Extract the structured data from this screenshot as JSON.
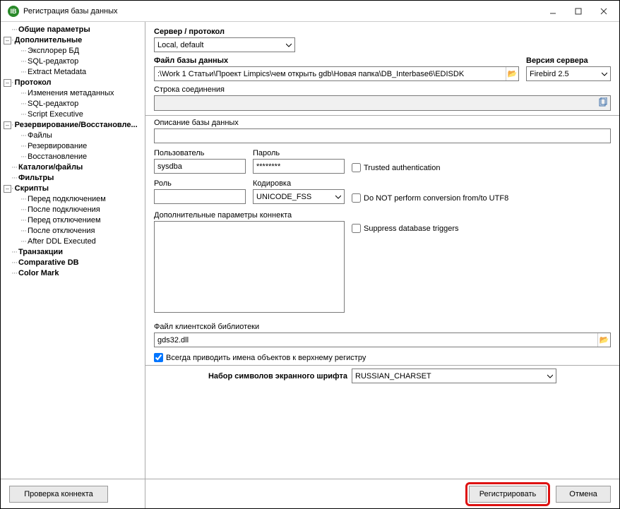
{
  "title": "Регистрация базы данных",
  "tree": {
    "general": "Общие параметры",
    "additional": "Дополнительные",
    "additional_children": [
      "Эксплорер БД",
      "SQL-редактор",
      "Extract Metadata"
    ],
    "protocol": "Протокол",
    "protocol_children": [
      "Изменения метаданных",
      "SQL-редактор",
      "Script Executive"
    ],
    "backup": "Резервирование/Восстановле...",
    "backup_children": [
      "Файлы",
      "Резервирование",
      "Восстановление"
    ],
    "catalogs": "Каталоги/файлы",
    "filters": "Фильтры",
    "scripts": "Скрипты",
    "scripts_children": [
      "Перед подключением",
      "После подключения",
      "Перед отключением",
      "После отключения",
      "After DDL Executed"
    ],
    "transactions": "Транзакции",
    "comparative": "Comparative DB",
    "colormark": "Color Mark"
  },
  "form": {
    "server_label": "Сервер / протокол",
    "server_value": "Local, default",
    "dbfile_label": "Файл базы данных",
    "dbfile_value": ":\\Work 1 Статьи\\Проект Limpics\\чем открыть gdb\\Новая папка\\DB_Interbase6\\EDISDK",
    "version_label": "Версия сервера",
    "version_value": "Firebird 2.5",
    "connstr_label": "Строка соединения",
    "desc_label": "Описание базы данных",
    "user_label": "Пользователь",
    "user_value": "sysdba",
    "pass_label": "Пароль",
    "pass_value": "********",
    "trusted_label": "Trusted authentication",
    "role_label": "Роль",
    "encoding_label": "Кодировка",
    "encoding_value": "UNICODE_FSS",
    "noconvert_label": "Do NOT perform conversion from/to UTF8",
    "addparams_label": "Дополнительные параметры коннекта",
    "suppress_label": "Suppress database triggers",
    "clientlib_label": "Файл клиентской библиотеки",
    "clientlib_value": "gds32.dll",
    "uppercase_label": "Всегда приводить имена объектов к верхнему регистру",
    "charset_label": "Набор символов экранного шрифта",
    "charset_value": "RUSSIAN_CHARSET"
  },
  "buttons": {
    "test": "Проверка коннекта",
    "register": "Регистрировать",
    "cancel": "Отмена"
  }
}
